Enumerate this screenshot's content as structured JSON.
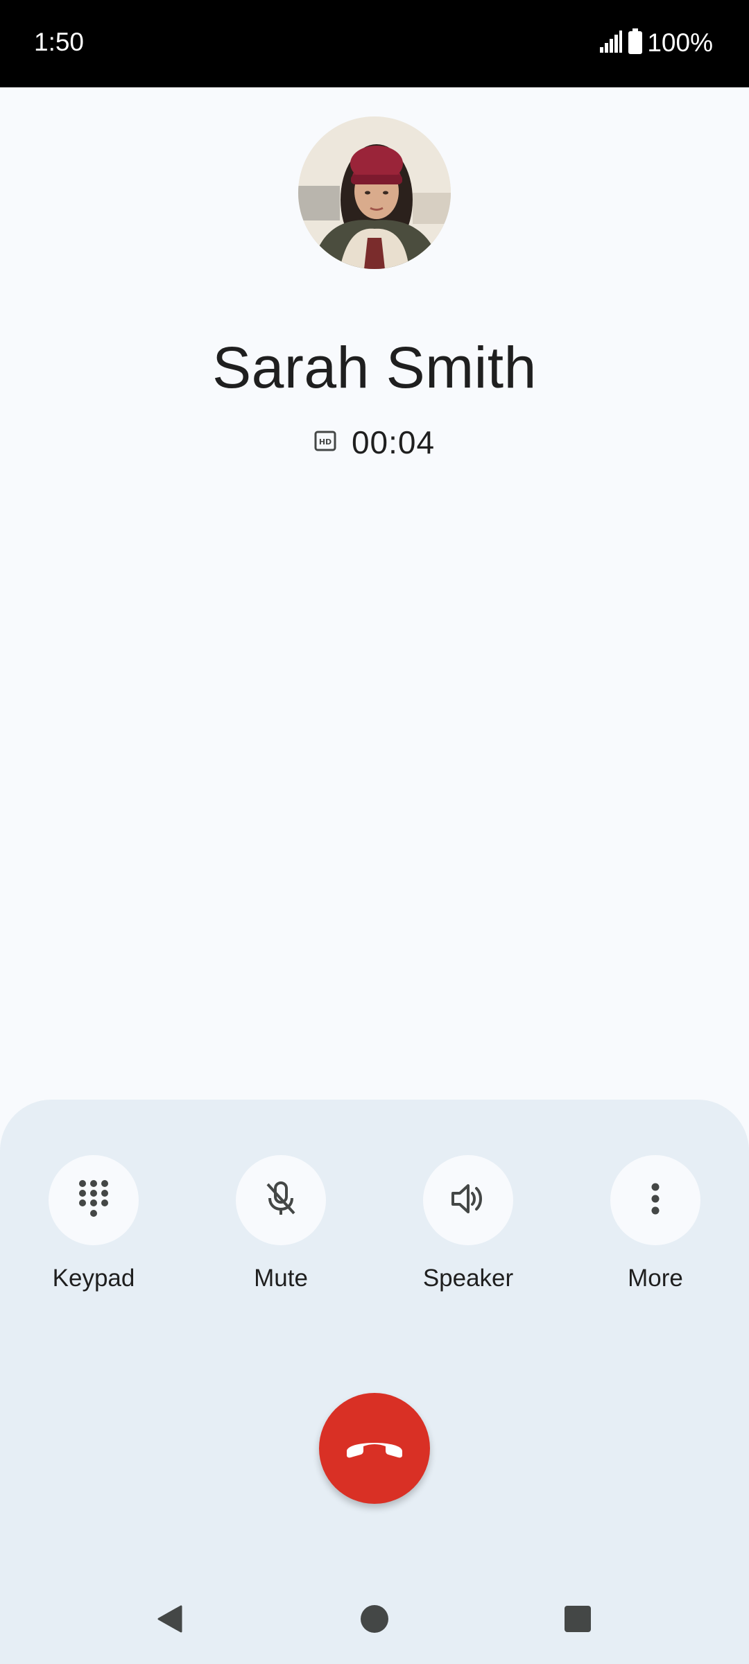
{
  "status_bar": {
    "time": "1:50",
    "battery_percent": "100%",
    "icons": [
      "signal-icon",
      "battery-icon"
    ]
  },
  "call": {
    "contact_name": "Sarah Smith",
    "duration": "00:04",
    "hd_badge_icon": "hd-icon"
  },
  "controls": [
    {
      "label": "Keypad",
      "icon": "dialpad-icon"
    },
    {
      "label": "Mute",
      "icon": "mic-off-icon"
    },
    {
      "label": "Speaker",
      "icon": "speaker-icon"
    },
    {
      "label": "More",
      "icon": "more-vert-icon"
    }
  ],
  "end_call": {
    "icon": "call-end-icon",
    "color": "#d93025"
  },
  "nav": {
    "icons": [
      "back-icon",
      "home-icon",
      "recents-icon"
    ]
  },
  "colors": {
    "background": "#f8fafd",
    "sheet": "#e6eef5",
    "end_call": "#d93025",
    "text": "#1f1f1f"
  }
}
